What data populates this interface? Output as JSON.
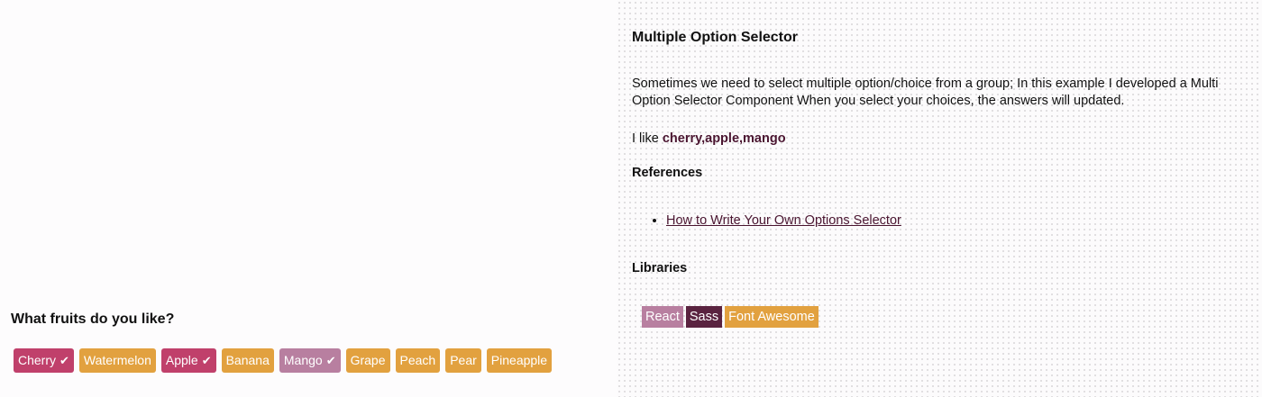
{
  "left": {
    "question": "What fruits do you like?",
    "options": [
      {
        "label": "Cherry",
        "selected": true,
        "color": "#c0406b"
      },
      {
        "label": "Watermelon",
        "selected": false,
        "color": "#e2a13f"
      },
      {
        "label": "Apple",
        "selected": true,
        "color": "#c0406b"
      },
      {
        "label": "Banana",
        "selected": false,
        "color": "#e2a13f"
      },
      {
        "label": "Mango",
        "selected": true,
        "color": "#b87fa0"
      },
      {
        "label": "Grape",
        "selected": false,
        "color": "#e2a13f"
      },
      {
        "label": "Peach",
        "selected": false,
        "color": "#e2a13f"
      },
      {
        "label": "Pear",
        "selected": false,
        "color": "#e2a13f"
      },
      {
        "label": "Pineapple",
        "selected": false,
        "color": "#e2a13f"
      }
    ],
    "check_icon": "check-icon"
  },
  "right": {
    "title": "Multiple Option Selector",
    "description": "Sometimes we need to select multiple option/choice from a group; In this example I developed a Multi Option Selector Component When you select your choices, the answers will updated.",
    "answer_prefix": "I like ",
    "answer_value": "cherry,apple,mango",
    "references_heading": "References",
    "references": [
      "How to Write Your Own Options Selector"
    ],
    "libraries_heading": "Libraries",
    "libraries": [
      {
        "label": "React",
        "color": "#b87fa0"
      },
      {
        "label": "Sass",
        "color": "#5a2340"
      },
      {
        "label": "Font Awesome",
        "color": "#e2a13f"
      }
    ]
  }
}
